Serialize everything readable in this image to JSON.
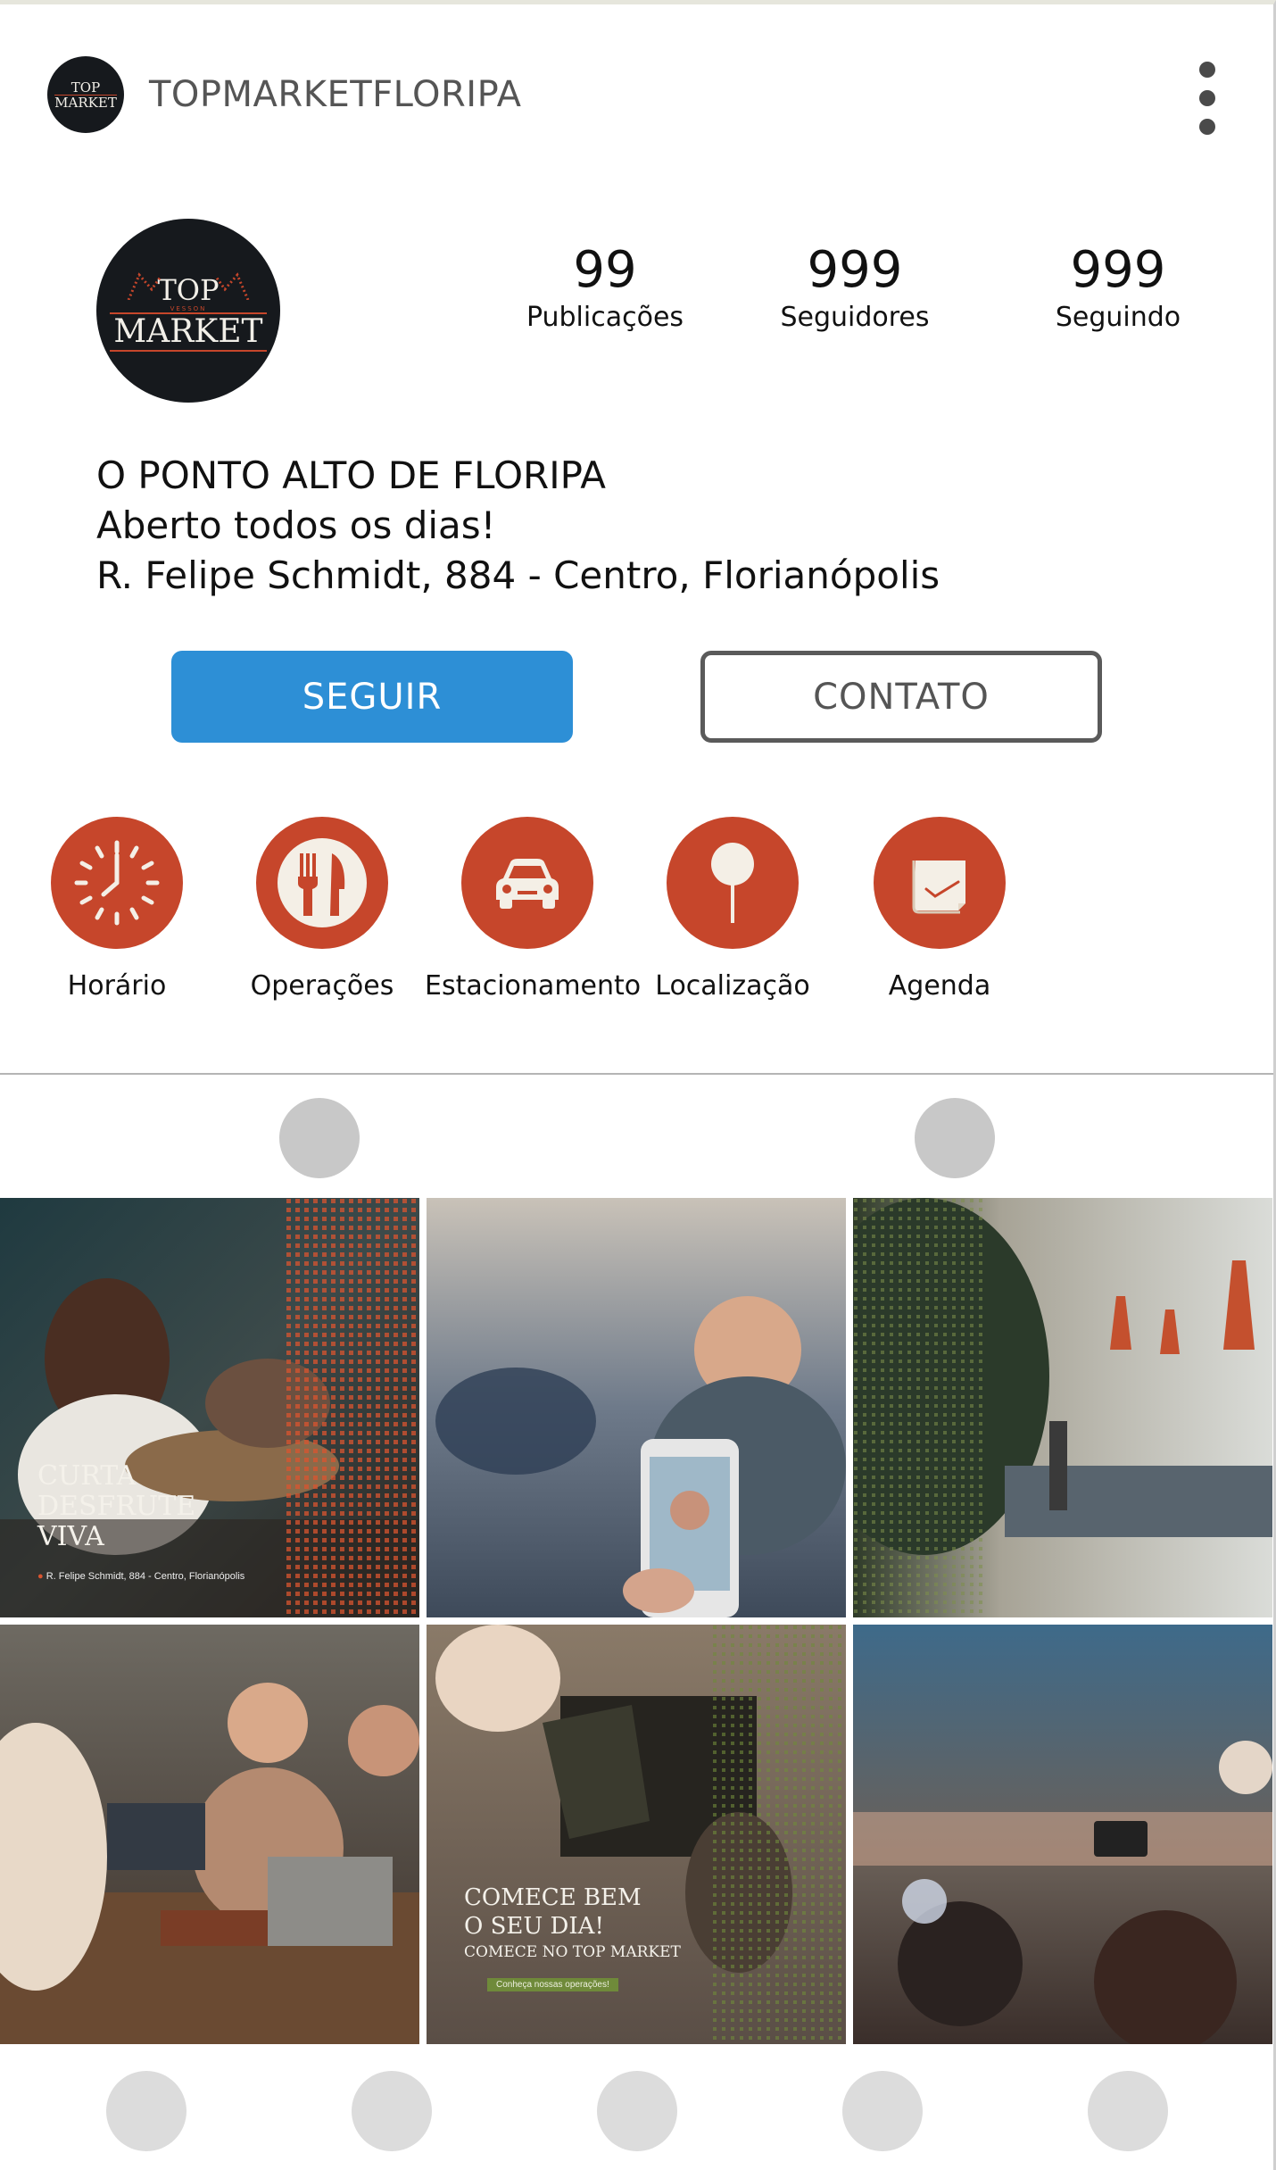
{
  "header": {
    "username": "TOPMARKETFLORIPA",
    "logo_line1": "TOP",
    "logo_line2": "MARKET",
    "menu_icon": "more-vertical-icon"
  },
  "profile": {
    "logo_line1": "TOP",
    "logo_small": "VESSON",
    "logo_line2": "MARKET",
    "stats": [
      {
        "value": "99",
        "label": "Publicações"
      },
      {
        "value": "999",
        "label": "Seguidores"
      },
      {
        "value": "999",
        "label": "Seguindo"
      }
    ],
    "bio": [
      "O PONTO ALTO DE FLORIPA",
      "Aberto todos os dias!",
      "R. Felipe Schmidt, 884 - Centro, Florianópolis"
    ]
  },
  "actions": {
    "follow_label": "SEGUIR",
    "contact_label": "CONTATO"
  },
  "highlights": [
    {
      "label": "Horário",
      "icon": "clock-icon"
    },
    {
      "label": "Operações",
      "icon": "fork-knife-icon"
    },
    {
      "label": "Estacionamento",
      "icon": "car-icon"
    },
    {
      "label": "Localização",
      "icon": "pin-icon"
    },
    {
      "label": "Agenda",
      "icon": "notepad-icon"
    }
  ],
  "posts": {
    "post1": {
      "line1": "CURTA",
      "line2": "DESFRUTE",
      "line3": "VIVA",
      "address": "R. Felipe Schmidt, 884 - Centro, Florianópolis"
    },
    "post5": {
      "line1": "COMECE BEM",
      "line2": "O SEU DIA!",
      "line3": "COMECE NO TOP MARKET",
      "cta": "Conheça nossas operações!"
    }
  },
  "colors": {
    "accent": "#c6462b",
    "follow": "#2d8fd6",
    "logo_bg": "#16191d"
  }
}
